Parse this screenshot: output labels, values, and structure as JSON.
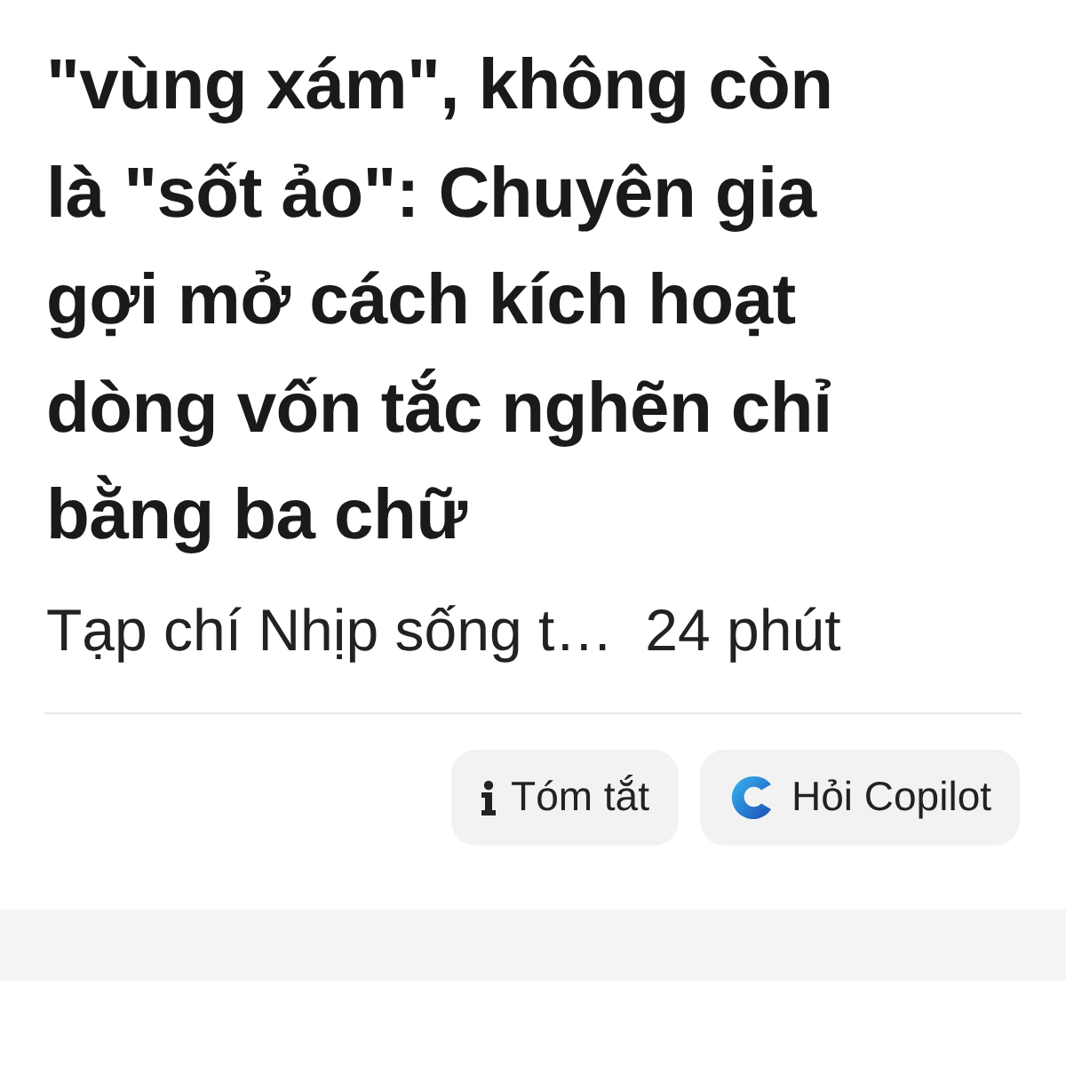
{
  "headline_lines": [
    "\"vùng xám\", không còn",
    "là \"sốt ảo\": Chuyên gia",
    "gợi mở cách kích hoạt",
    "dòng vốn tắc nghẽn chỉ",
    "bằng ba chữ"
  ],
  "source": "Tạp chí Nhịp sống t…",
  "age": "24 phút",
  "actions": [
    {
      "kind": "info",
      "label": "Tóm tắt"
    },
    {
      "kind": "copilot",
      "label": "Hỏi Copilot"
    }
  ]
}
